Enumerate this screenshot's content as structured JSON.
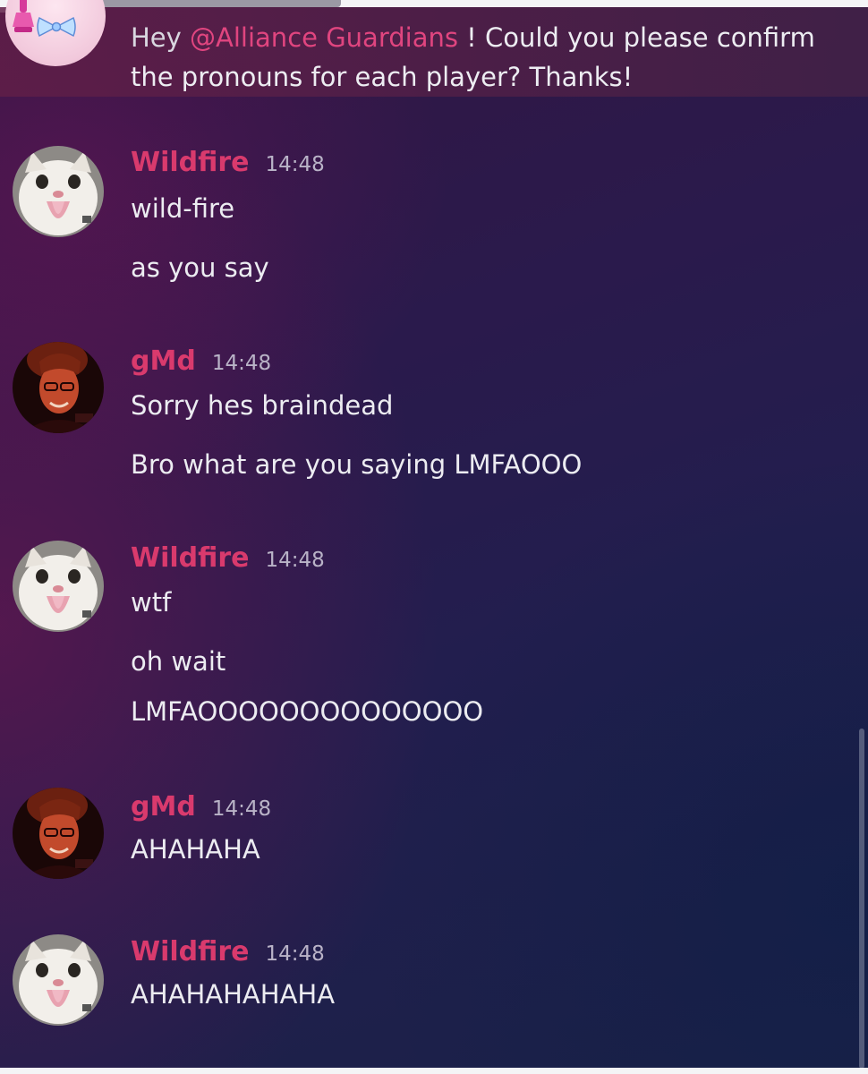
{
  "context_message": {
    "greeting": "Hey ",
    "mention": "@Alliance Guardians",
    "text_line1": " ! Could you please confirm",
    "text_line2": "the pronouns for each player? Thanks!"
  },
  "messages": [
    {
      "author": "Wildfire",
      "timestamp": "14:48",
      "avatar": "cat-avatar",
      "lines": [
        "wild-fire",
        "as you say"
      ]
    },
    {
      "author": "gMd",
      "timestamp": "14:48",
      "avatar": "person-avatar",
      "lines": [
        "Sorry hes braindead",
        "Bro what are you saying LMFAOOO"
      ]
    },
    {
      "author": "Wildfire",
      "timestamp": "14:48",
      "avatar": "cat-avatar",
      "lines": [
        "wtf",
        "oh wait",
        "LMFAOOOOOOOOOOOOOO"
      ]
    },
    {
      "author": "gMd",
      "timestamp": "14:48",
      "avatar": "person-avatar",
      "lines": [
        "AHAHAHA"
      ]
    },
    {
      "author": "Wildfire",
      "timestamp": "14:48",
      "avatar": "cat-avatar",
      "lines": [
        "AHAHAHAHAHA"
      ]
    }
  ],
  "colors": {
    "author": "#d93a6d",
    "mention": "#e0457f",
    "text": "#ececf1",
    "timestamp": "#b9b3c7"
  }
}
